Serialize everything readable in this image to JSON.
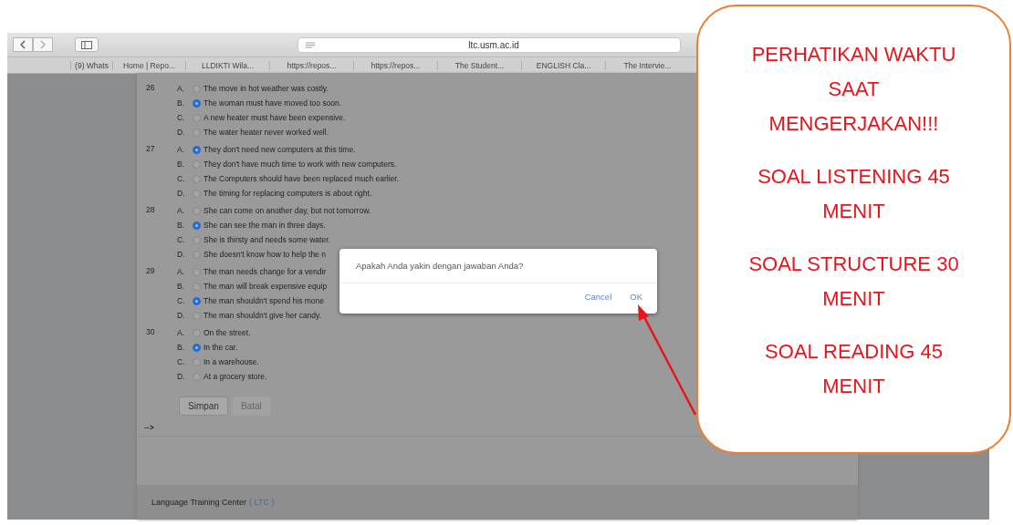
{
  "browser": {
    "url": "ltc.usm.ac.id",
    "bookmarks": [
      "(9) Whats",
      "Home | Repo...",
      "LLDIKTI Wila...",
      "https://repos...",
      "https://repos...",
      "The Student...",
      "ENGLISH Cla...",
      "The Intervie..."
    ]
  },
  "questions": [
    {
      "number": "26",
      "options": [
        {
          "letter": "A.",
          "text": "The move in hot weather was costly.",
          "selected": false
        },
        {
          "letter": "B.",
          "text": "The woman must have moved too soon.",
          "selected": true
        },
        {
          "letter": "C.",
          "text": "A new heater must have been expensive.",
          "selected": false
        },
        {
          "letter": "D.",
          "text": "The water heater never worked well.",
          "selected": false
        }
      ]
    },
    {
      "number": "27",
      "options": [
        {
          "letter": "A.",
          "text": "They don't need new computers at this time.",
          "selected": true
        },
        {
          "letter": "B.",
          "text": "They don't have much time to work with new computers.",
          "selected": false
        },
        {
          "letter": "C.",
          "text": "The Computers should have been replaced much earlier.",
          "selected": false
        },
        {
          "letter": "D.",
          "text": "The timing for replacing computers is about right.",
          "selected": false
        }
      ]
    },
    {
      "number": "28",
      "options": [
        {
          "letter": "A.",
          "text": "She can come on another day, but not tomorrow.",
          "selected": false
        },
        {
          "letter": "B.",
          "text": "She can see the man in three days.",
          "selected": true
        },
        {
          "letter": "C.",
          "text": "She is thirsty and needs some water.",
          "selected": false
        },
        {
          "letter": "D.",
          "text": "She doesn't know how to help the n",
          "selected": false
        }
      ]
    },
    {
      "number": "29",
      "options": [
        {
          "letter": "A.",
          "text": "The man needs change for a vendir",
          "selected": false
        },
        {
          "letter": "B.",
          "text": "The man will break expensive equip",
          "selected": false
        },
        {
          "letter": "C.",
          "text": "The man shouldn't spend his mone",
          "selected": true
        },
        {
          "letter": "D.",
          "text": "The man shouldn't give her candy.",
          "selected": false
        }
      ]
    },
    {
      "number": "30",
      "options": [
        {
          "letter": "A.",
          "text": "On the street.",
          "selected": false
        },
        {
          "letter": "B.",
          "text": "In the car.",
          "selected": true
        },
        {
          "letter": "C.",
          "text": "In a warehouse.",
          "selected": false
        },
        {
          "letter": "D.",
          "text": "At a grocery store.",
          "selected": false
        }
      ]
    }
  ],
  "form_buttons": [
    {
      "label": "Simpan",
      "disabled": false
    },
    {
      "label": "Batal",
      "disabled": true
    }
  ],
  "marker": "-->",
  "footer": {
    "text": "Language Training Center",
    "link": "( LTC )"
  },
  "dialog": {
    "message": "Apakah Anda yakin dengan jawaban Anda?",
    "buttons": [
      "Cancel",
      "OK"
    ]
  },
  "callout": {
    "paragraphs": [
      "PERHATIKAN WAKTU SAAT MENGERJAKAN!!!",
      "SOAL LISTENING 45 MENIT",
      "SOAL STRUCTURE 30 MENIT",
      "SOAL READING 45 MENIT"
    ]
  }
}
